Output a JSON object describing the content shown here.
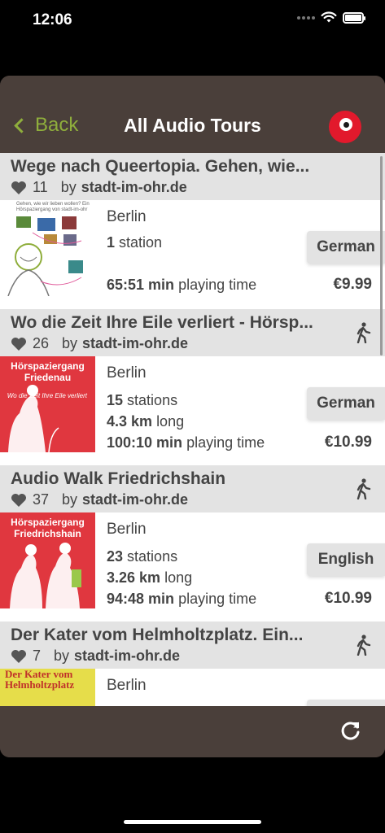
{
  "status_bar": {
    "time": "12:06"
  },
  "nav": {
    "back_label": "Back",
    "title": "All Audio Tours"
  },
  "tours": [
    {
      "title": "Wege nach Queertopia. Gehen, wie...",
      "likes": "11",
      "by": "by",
      "author": "stadt-im-ohr.de",
      "city": "Berlin",
      "stations_num": "1",
      "stations_label": "station",
      "duration": "65:51 min",
      "duration_label": "playing time",
      "language": "German",
      "price": "€9.99",
      "thumb_caption": "Gehen, wie wir lieben wollen? Ein Hörspaziergang von stadt-im-ohr"
    },
    {
      "title": "Wo die Zeit Ihre Eile verliert - Hörsp...",
      "likes": "26",
      "by": "by",
      "author": "stadt-im-ohr.de",
      "city": "Berlin",
      "stations_num": "15",
      "stations_label": "stations",
      "distance": "4.3 km",
      "distance_label": "long",
      "duration": "100:10 min",
      "duration_label": "playing time",
      "language": "German",
      "price": "€10.99",
      "thumb_caption": "Hörspaziergang Friedenau",
      "thumb_sub": "Wo die Zeit Ihre Eile verliert"
    },
    {
      "title": "Audio Walk Friedrichshain",
      "likes": "37",
      "by": "by",
      "author": "stadt-im-ohr.de",
      "city": "Berlin",
      "stations_num": "23",
      "stations_label": "stations",
      "distance": "3.26 km",
      "distance_label": "long",
      "duration": "94:48 min",
      "duration_label": "playing time",
      "language": "English",
      "price": "€10.99",
      "thumb_caption": "Hörspaziergang Friedrichshain"
    },
    {
      "title": "Der Kater vom Helmholtzplatz. Ein...",
      "likes": "7",
      "by": "by",
      "author": "stadt-im-ohr.de",
      "city": "Berlin",
      "thumb_caption": "Der Kater vom Helmholtzplatz"
    }
  ],
  "colors": {
    "nav_bg": "#4a3f3a",
    "accent_green": "#8fae3c",
    "logo_red": "#e2192c",
    "header_gray": "#e3e3e3"
  }
}
